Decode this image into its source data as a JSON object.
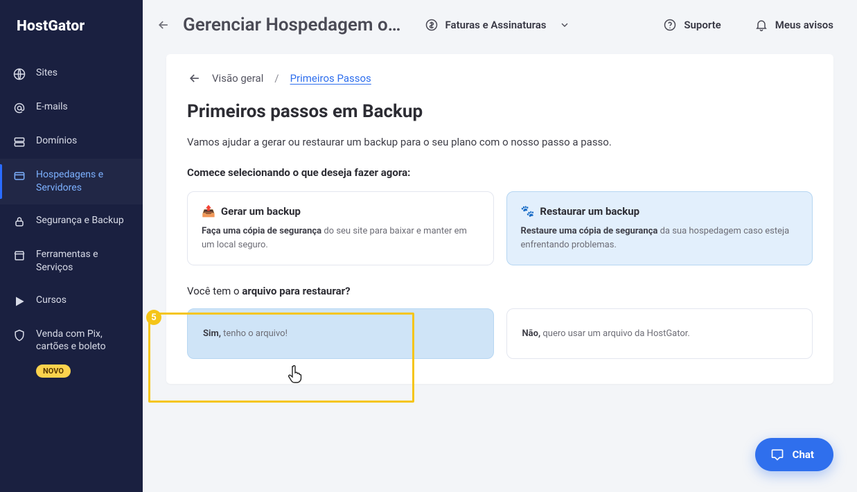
{
  "brand": "HostGator",
  "sidebar": {
    "items": [
      {
        "icon": "globe",
        "label": "Sites"
      },
      {
        "icon": "at",
        "label": "E-mails"
      },
      {
        "icon": "server",
        "label": "Domínios"
      },
      {
        "icon": "layers",
        "label": "Hospedagens e Servidores"
      },
      {
        "icon": "lock",
        "label": "Segurança e Backup"
      },
      {
        "icon": "store",
        "label": "Ferramentas e Serviços"
      },
      {
        "icon": "play",
        "label": "Cursos"
      },
      {
        "icon": "shield",
        "label": "Venda com Pix, cartões e boleto"
      }
    ],
    "novo_badge": "NOVO"
  },
  "topbar": {
    "title": "Gerenciar Hospedagem o…",
    "invoices": "Faturas e Assinaturas",
    "support": "Suporte",
    "notices": "Meus avisos"
  },
  "breadcrumb": {
    "root": "Visão geral",
    "current": "Primeiros Passos"
  },
  "page": {
    "title": "Primeiros passos em Backup",
    "intro": "Vamos ajudar a gerar ou restaurar um backup para o seu plano com o nosso passo a passo.",
    "subhead": "Comece selecionando o que deseja fazer agora:",
    "options": [
      {
        "emoji": "📤",
        "title": "Gerar um backup",
        "body_bold": "Faça uma cópia de segurança",
        "body_rest": " do seu site para baixar e manter em um local seguro."
      },
      {
        "emoji": "🐾",
        "title": "Restaurar um backup",
        "body_bold": "Restaure uma cópia de segurança",
        "body_rest": " da sua hospedagem caso esteja enfrentando problemas."
      }
    ],
    "question2_pre": "Você tem o ",
    "question2_bold": "arquivo para restaurar?",
    "answers": [
      {
        "bold": "Sim,",
        "rest": " tenho o arquivo!"
      },
      {
        "bold": "Não,",
        "rest": " quero usar um arquivo da HostGator."
      }
    ]
  },
  "highlight": {
    "number": "5"
  },
  "chat": {
    "label": "Chat"
  }
}
